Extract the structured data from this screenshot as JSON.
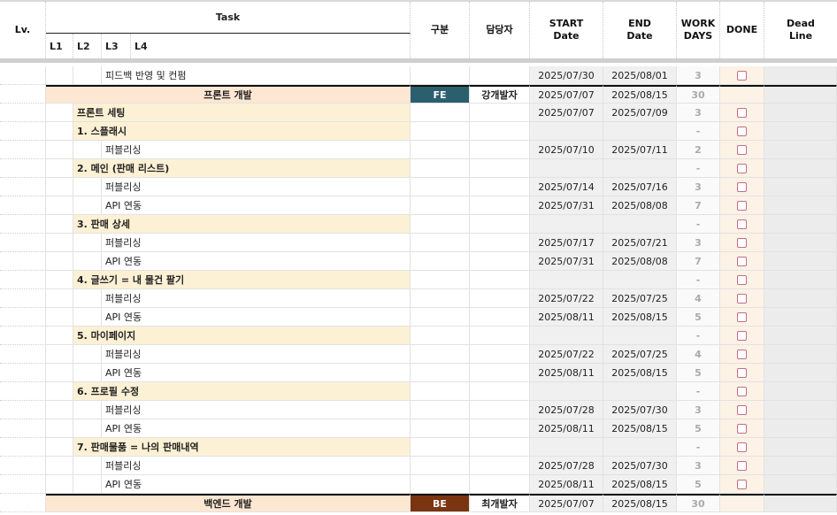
{
  "header": {
    "lv": "Lv.",
    "task": "Task",
    "levels": [
      "L1",
      "L2",
      "L3",
      "L4"
    ],
    "category": "구분",
    "assignee": "담당자",
    "start": [
      "START",
      "Date"
    ],
    "end": [
      "END",
      "Date"
    ],
    "work_days": [
      "WORK",
      "DAYS"
    ],
    "done": "DONE",
    "deadline": [
      "Dead",
      "Line"
    ]
  },
  "colors": {
    "fe_tag": "#2c5f6e",
    "be_tag": "#7a3410",
    "section_bg": "#fde7d2",
    "group_bg": "#fdf1d5",
    "checkbox_border": "#c76c86"
  },
  "rows": [
    {
      "kind": "task",
      "level": 3,
      "label": "피드백 반영 및 컨펌",
      "start": "2025/07/30",
      "end": "2025/08/01",
      "days": "3"
    },
    {
      "kind": "section",
      "label": "프론트 개발",
      "tag": "FE",
      "tag_color": "#2c5f6e",
      "assignee": "강개발자",
      "start": "2025/07/07",
      "end": "2025/08/15",
      "days": "30"
    },
    {
      "kind": "group",
      "level": 2,
      "label": "프론트 세팅",
      "start": "2025/07/07",
      "end": "2025/07/09",
      "days": "3"
    },
    {
      "kind": "group",
      "level": 2,
      "label": "1. 스플래시",
      "start": "",
      "end": "",
      "days": "-"
    },
    {
      "kind": "task",
      "level": 3,
      "label": "퍼블리싱",
      "start": "2025/07/10",
      "end": "2025/07/11",
      "days": "2"
    },
    {
      "kind": "group",
      "level": 2,
      "label": "2. 메인 (판매 리스트)",
      "start": "",
      "end": "",
      "days": "-"
    },
    {
      "kind": "task",
      "level": 3,
      "label": "퍼블리싱",
      "start": "2025/07/14",
      "end": "2025/07/16",
      "days": "3"
    },
    {
      "kind": "task",
      "level": 3,
      "label": "API 연동",
      "start": "2025/07/31",
      "end": "2025/08/08",
      "days": "7"
    },
    {
      "kind": "group",
      "level": 2,
      "label": "3. 판매 상세",
      "start": "",
      "end": "",
      "days": "-"
    },
    {
      "kind": "task",
      "level": 3,
      "label": "퍼블리싱",
      "start": "2025/07/17",
      "end": "2025/07/21",
      "days": "3"
    },
    {
      "kind": "task",
      "level": 3,
      "label": "API 연동",
      "start": "2025/07/31",
      "end": "2025/08/08",
      "days": "7"
    },
    {
      "kind": "group",
      "level": 2,
      "label": "4. 글쓰기 = 내 물건 팔기",
      "start": "",
      "end": "",
      "days": "-"
    },
    {
      "kind": "task",
      "level": 3,
      "label": "퍼블리싱",
      "start": "2025/07/22",
      "end": "2025/07/25",
      "days": "4"
    },
    {
      "kind": "task",
      "level": 3,
      "label": "API 연동",
      "start": "2025/08/11",
      "end": "2025/08/15",
      "days": "5"
    },
    {
      "kind": "group",
      "level": 2,
      "label": "5. 마이페이지",
      "start": "",
      "end": "",
      "days": "-"
    },
    {
      "kind": "task",
      "level": 3,
      "label": "퍼블리싱",
      "start": "2025/07/22",
      "end": "2025/07/25",
      "days": "4"
    },
    {
      "kind": "task",
      "level": 3,
      "label": "API 연동",
      "start": "2025/08/11",
      "end": "2025/08/15",
      "days": "5"
    },
    {
      "kind": "group",
      "level": 2,
      "label": "6. 프로필 수정",
      "start": "",
      "end": "",
      "days": "-"
    },
    {
      "kind": "task",
      "level": 3,
      "label": "퍼블리싱",
      "start": "2025/07/28",
      "end": "2025/07/30",
      "days": "3"
    },
    {
      "kind": "task",
      "level": 3,
      "label": "API 연동",
      "start": "2025/08/11",
      "end": "2025/08/15",
      "days": "5"
    },
    {
      "kind": "group",
      "level": 2,
      "label": "7. 판매물품 = 나의 판매내역",
      "start": "",
      "end": "",
      "days": "-"
    },
    {
      "kind": "task",
      "level": 3,
      "label": "퍼블리싱",
      "start": "2025/07/28",
      "end": "2025/07/30",
      "days": "3"
    },
    {
      "kind": "task",
      "level": 3,
      "label": "API 연동",
      "start": "2025/08/11",
      "end": "2025/08/15",
      "days": "5"
    },
    {
      "kind": "section",
      "label": "백엔드 개발",
      "tag": "BE",
      "tag_color": "#7a3410",
      "assignee": "최개발자",
      "start": "2025/07/07",
      "end": "2025/08/15",
      "days": "30"
    }
  ]
}
